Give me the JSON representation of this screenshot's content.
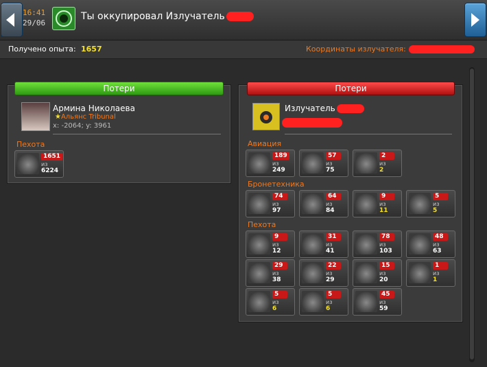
{
  "header": {
    "time": "16:41",
    "date": "29/06",
    "title": "Ты оккупировал Излучатель",
    "experience_label": "Получено опыта:",
    "experience_value": "1657",
    "coords_label": "Координаты излучателя:"
  },
  "attacker": {
    "header": "Потери",
    "name": "Армина Николаева",
    "alliance": "Альянс Tribunal",
    "coords": "x: -2064; y: 3961",
    "sections": [
      {
        "title": "Пехота",
        "units": [
          {
            "lost": "1651",
            "of": "из",
            "total": "6224"
          }
        ]
      }
    ]
  },
  "defender": {
    "header": "Потери",
    "name": "Излучатель",
    "sections": [
      {
        "title": "Авиация",
        "units": [
          {
            "lost": "189",
            "of": "из",
            "total": "249"
          },
          {
            "lost": "57",
            "of": "из",
            "total": "75"
          },
          {
            "lost": "2",
            "of": "из",
            "total": "2",
            "gold": true
          }
        ]
      },
      {
        "title": "Бронетехника",
        "units": [
          {
            "lost": "74",
            "of": "из",
            "total": "97"
          },
          {
            "lost": "64",
            "of": "из",
            "total": "84"
          },
          {
            "lost": "9",
            "of": "из",
            "total": "11",
            "gold": true
          },
          {
            "lost": "5",
            "of": "из",
            "total": "5",
            "gold": true
          }
        ]
      },
      {
        "title": "Пехота",
        "units": [
          {
            "lost": "9",
            "of": "из",
            "total": "12"
          },
          {
            "lost": "31",
            "of": "из",
            "total": "41"
          },
          {
            "lost": "78",
            "of": "из",
            "total": "103"
          },
          {
            "lost": "48",
            "of": "из",
            "total": "63"
          },
          {
            "lost": "29",
            "of": "из",
            "total": "38"
          },
          {
            "lost": "22",
            "of": "из",
            "total": "29"
          },
          {
            "lost": "15",
            "of": "из",
            "total": "20"
          },
          {
            "lost": "1",
            "of": "из",
            "total": "1",
            "gold": true
          },
          {
            "lost": "5",
            "of": "из",
            "total": "6",
            "gold": true
          },
          {
            "lost": "5",
            "of": "из",
            "total": "6",
            "gold": true
          },
          {
            "lost": "45",
            "of": "из",
            "total": "59"
          }
        ]
      }
    ]
  },
  "colors": {
    "accent": "#ee7a22",
    "gold": "#f5e02a",
    "loss_red": "#c81818",
    "good_green": "#2e9a12"
  },
  "icons": [
    "chevron-left-icon",
    "chevron-right-icon",
    "emitter-icon",
    "star-icon",
    "unit-icon"
  ]
}
